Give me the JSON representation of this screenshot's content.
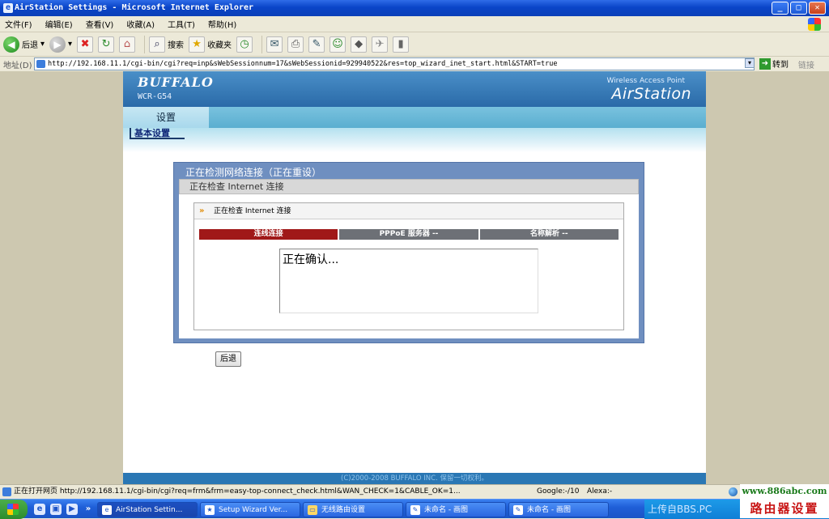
{
  "window": {
    "title": "AirStation Settings - Microsoft Internet Explorer"
  },
  "menubar": {
    "items": [
      "文件(F)",
      "编辑(E)",
      "查看(V)",
      "收藏(A)",
      "工具(T)",
      "帮助(H)"
    ]
  },
  "toolbar": {
    "back_label": "后退",
    "search_label": "搜索",
    "favorites_label": "收藏夹"
  },
  "address": {
    "label": "地址(D)",
    "url": "http://192.168.11.1/cgi-bin/cgi?req=inp&sWebSessionnum=17&sWebSessionid=929940522&res=top_wizard_inet_start.html&START=true",
    "go_label": "转到",
    "links_label": "链接"
  },
  "header": {
    "brand": "BUFFALO",
    "model": "WCR-G54",
    "product_line": "Wireless Access Point",
    "product_name": "AirStation"
  },
  "nav": {
    "tab": "设置",
    "subtab": "基本设置"
  },
  "panel": {
    "title": "正在检测网络连接（正在重设）",
    "subtitle": "正在检查 Internet 连接",
    "section_title": "正在检查 Internet 连接",
    "steps": [
      "连线连接",
      "PPPoE 服务器 --",
      "名称解析 --"
    ],
    "message": "正在确认..."
  },
  "buttons": {
    "back": "后退"
  },
  "footer": {
    "copyright": "(C)2000-2008 BUFFALO INC. 保留一切权利。"
  },
  "status": {
    "text": "正在打开网页 http://192.168.11.1/cgi-bin/cgi?req=frm&frm=easy-top-connect_check.html&WAN_CHECK=1&CABLE_OK=1...",
    "google": "Google:-/10",
    "alexa": "Alexa:-"
  },
  "taskbar": {
    "tasks": [
      "AirStation Settin...",
      "Setup Wizard  Ver...",
      "无线路由设置",
      "未命名 - 画图",
      "未命名 - 画图"
    ],
    "tray_text": "上传自BBS.PC"
  },
  "watermark": {
    "url": "www.886abc.com",
    "text": "路由器设置"
  },
  "colors": {
    "accent": "#2a77b4",
    "active_step": "#a01818",
    "idle_step": "#6d7076",
    "panel": "#6f8fc0"
  }
}
